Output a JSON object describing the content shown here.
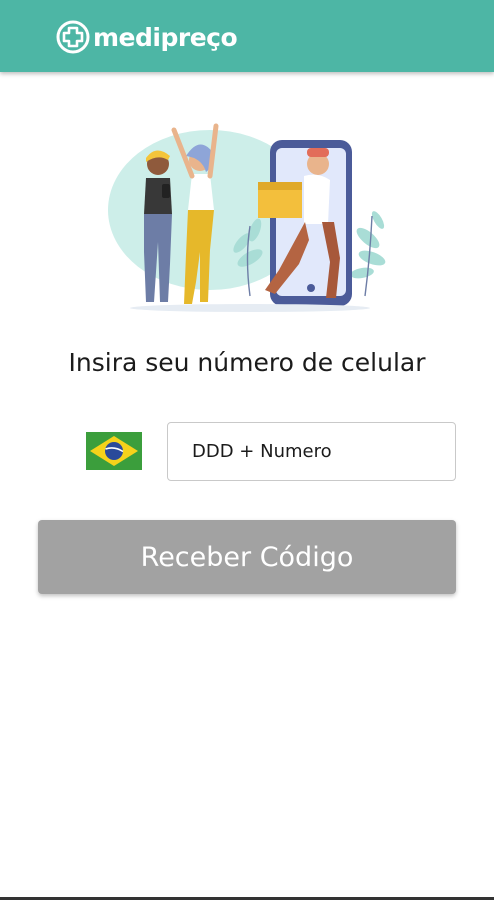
{
  "header": {
    "brand_name": "medipreço",
    "background_color": "#4db6a5",
    "logo_icon": "cross-icon"
  },
  "hero": {
    "illustration": "people-celebrating-delivery-from-phone"
  },
  "form": {
    "prompt": "Insira seu número de celular",
    "country_flag": "brazil-flag-icon",
    "phone_placeholder": "DDD + Numero",
    "submit_label": "Receber Código",
    "submit_color": "#a2a2a2"
  }
}
